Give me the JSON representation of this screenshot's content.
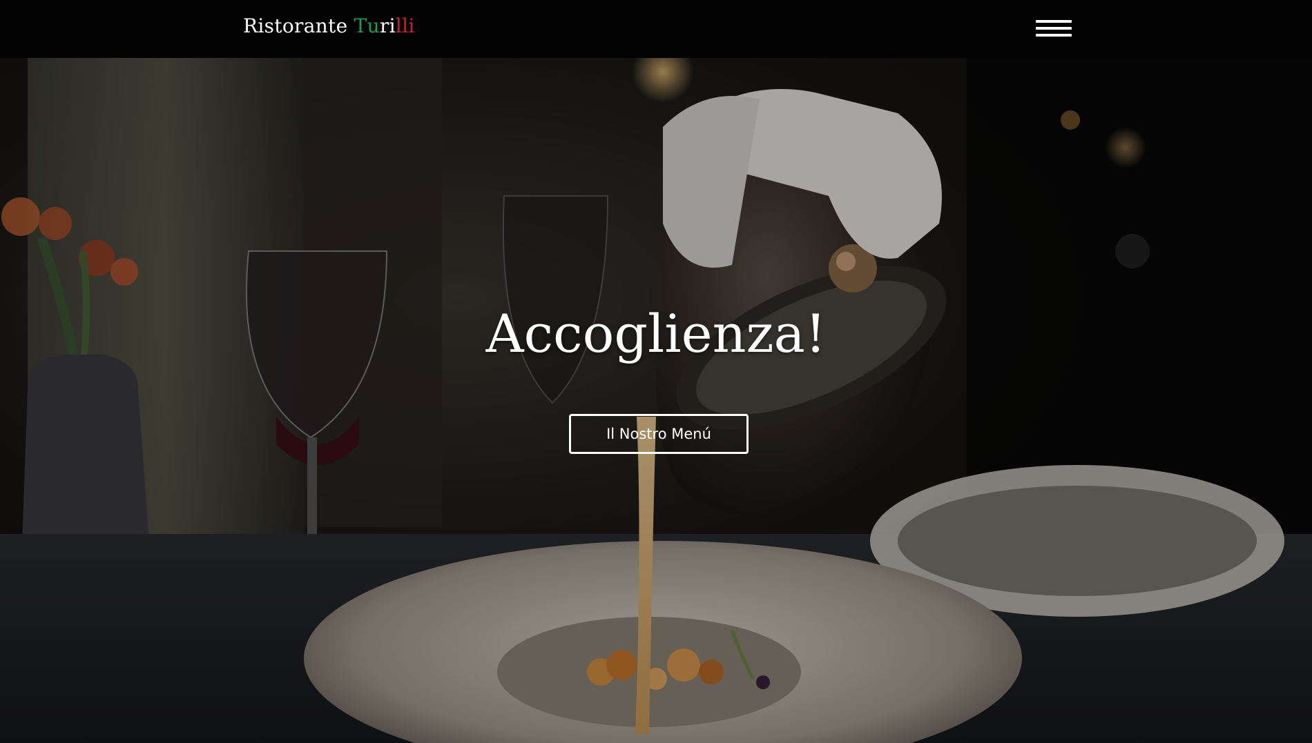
{
  "navbar": {
    "brand_part1": "Ristorante ",
    "brand_green": "Tu",
    "brand_white": "ri",
    "brand_red": "lli",
    "menu_icon": "hamburger-icon"
  },
  "hero": {
    "title": "Accoglienza!",
    "button_label": "Il Nostro Menú",
    "background_image": "fine-dining-pouring-sauce-photo"
  },
  "colors": {
    "navbar_bg": "#030303",
    "brand_green": "#1e9e4a",
    "brand_red": "#c4213a",
    "text": "#ffffff"
  }
}
